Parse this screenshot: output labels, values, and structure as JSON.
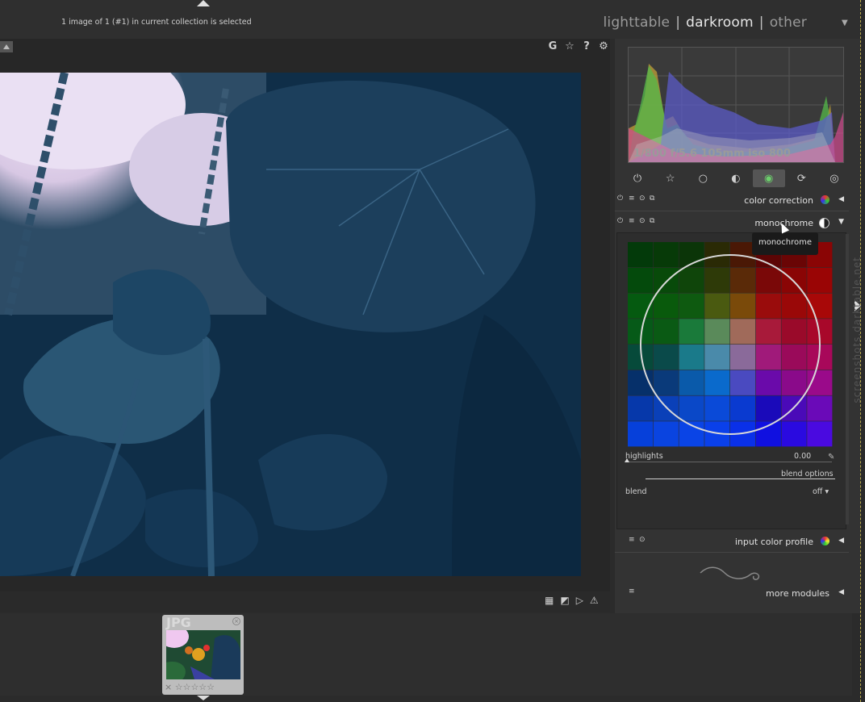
{
  "header": {
    "status": "1 image of 1 (#1) in current collection is selected",
    "views": [
      {
        "label": "lighttable",
        "active": false
      },
      {
        "label": "darkroom",
        "active": true
      },
      {
        "label": "other",
        "active": false
      }
    ],
    "separator": "|"
  },
  "center_toolbar": {
    "icons": [
      {
        "name": "guides",
        "glyph": "G"
      },
      {
        "name": "star-icon",
        "glyph": "☆"
      },
      {
        "name": "help-icon",
        "glyph": "?"
      },
      {
        "name": "gear-icon",
        "glyph": "⚙"
      }
    ]
  },
  "histogram": {
    "exif": "1/800 f/5.6 105mm iso 800"
  },
  "module_groups": [
    {
      "name": "power",
      "glyph": "⏻",
      "selected": false
    },
    {
      "name": "favorites",
      "glyph": "☆",
      "selected": false
    },
    {
      "name": "basic",
      "glyph": "○",
      "selected": false
    },
    {
      "name": "tone",
      "glyph": "◐",
      "selected": false
    },
    {
      "name": "color",
      "glyph": "◉",
      "selected": true
    },
    {
      "name": "correct",
      "glyph": "⟳",
      "selected": false
    },
    {
      "name": "effect",
      "glyph": "◎",
      "selected": false
    }
  ],
  "modules": {
    "color_correction": {
      "label": "color correction"
    },
    "monochrome": {
      "label": "monochrome",
      "tooltip": "monochrome",
      "highlights_label": "highlights",
      "highlights_value": "0.00",
      "highlights_fraction": 0.0,
      "blend_options": "blend options",
      "blend_label": "blend",
      "blend_value": "off ▾"
    },
    "input_color_profile": {
      "label": "input color profile"
    },
    "more_modules": {
      "label": "more modules"
    }
  },
  "filmstrip": {
    "thumb_format": "JPG",
    "stars": "☆☆☆☆☆"
  },
  "watermark": "screenshots.darktable.net",
  "colors": {
    "accent": "#555555",
    "photo_tint": "#0e2d47"
  }
}
